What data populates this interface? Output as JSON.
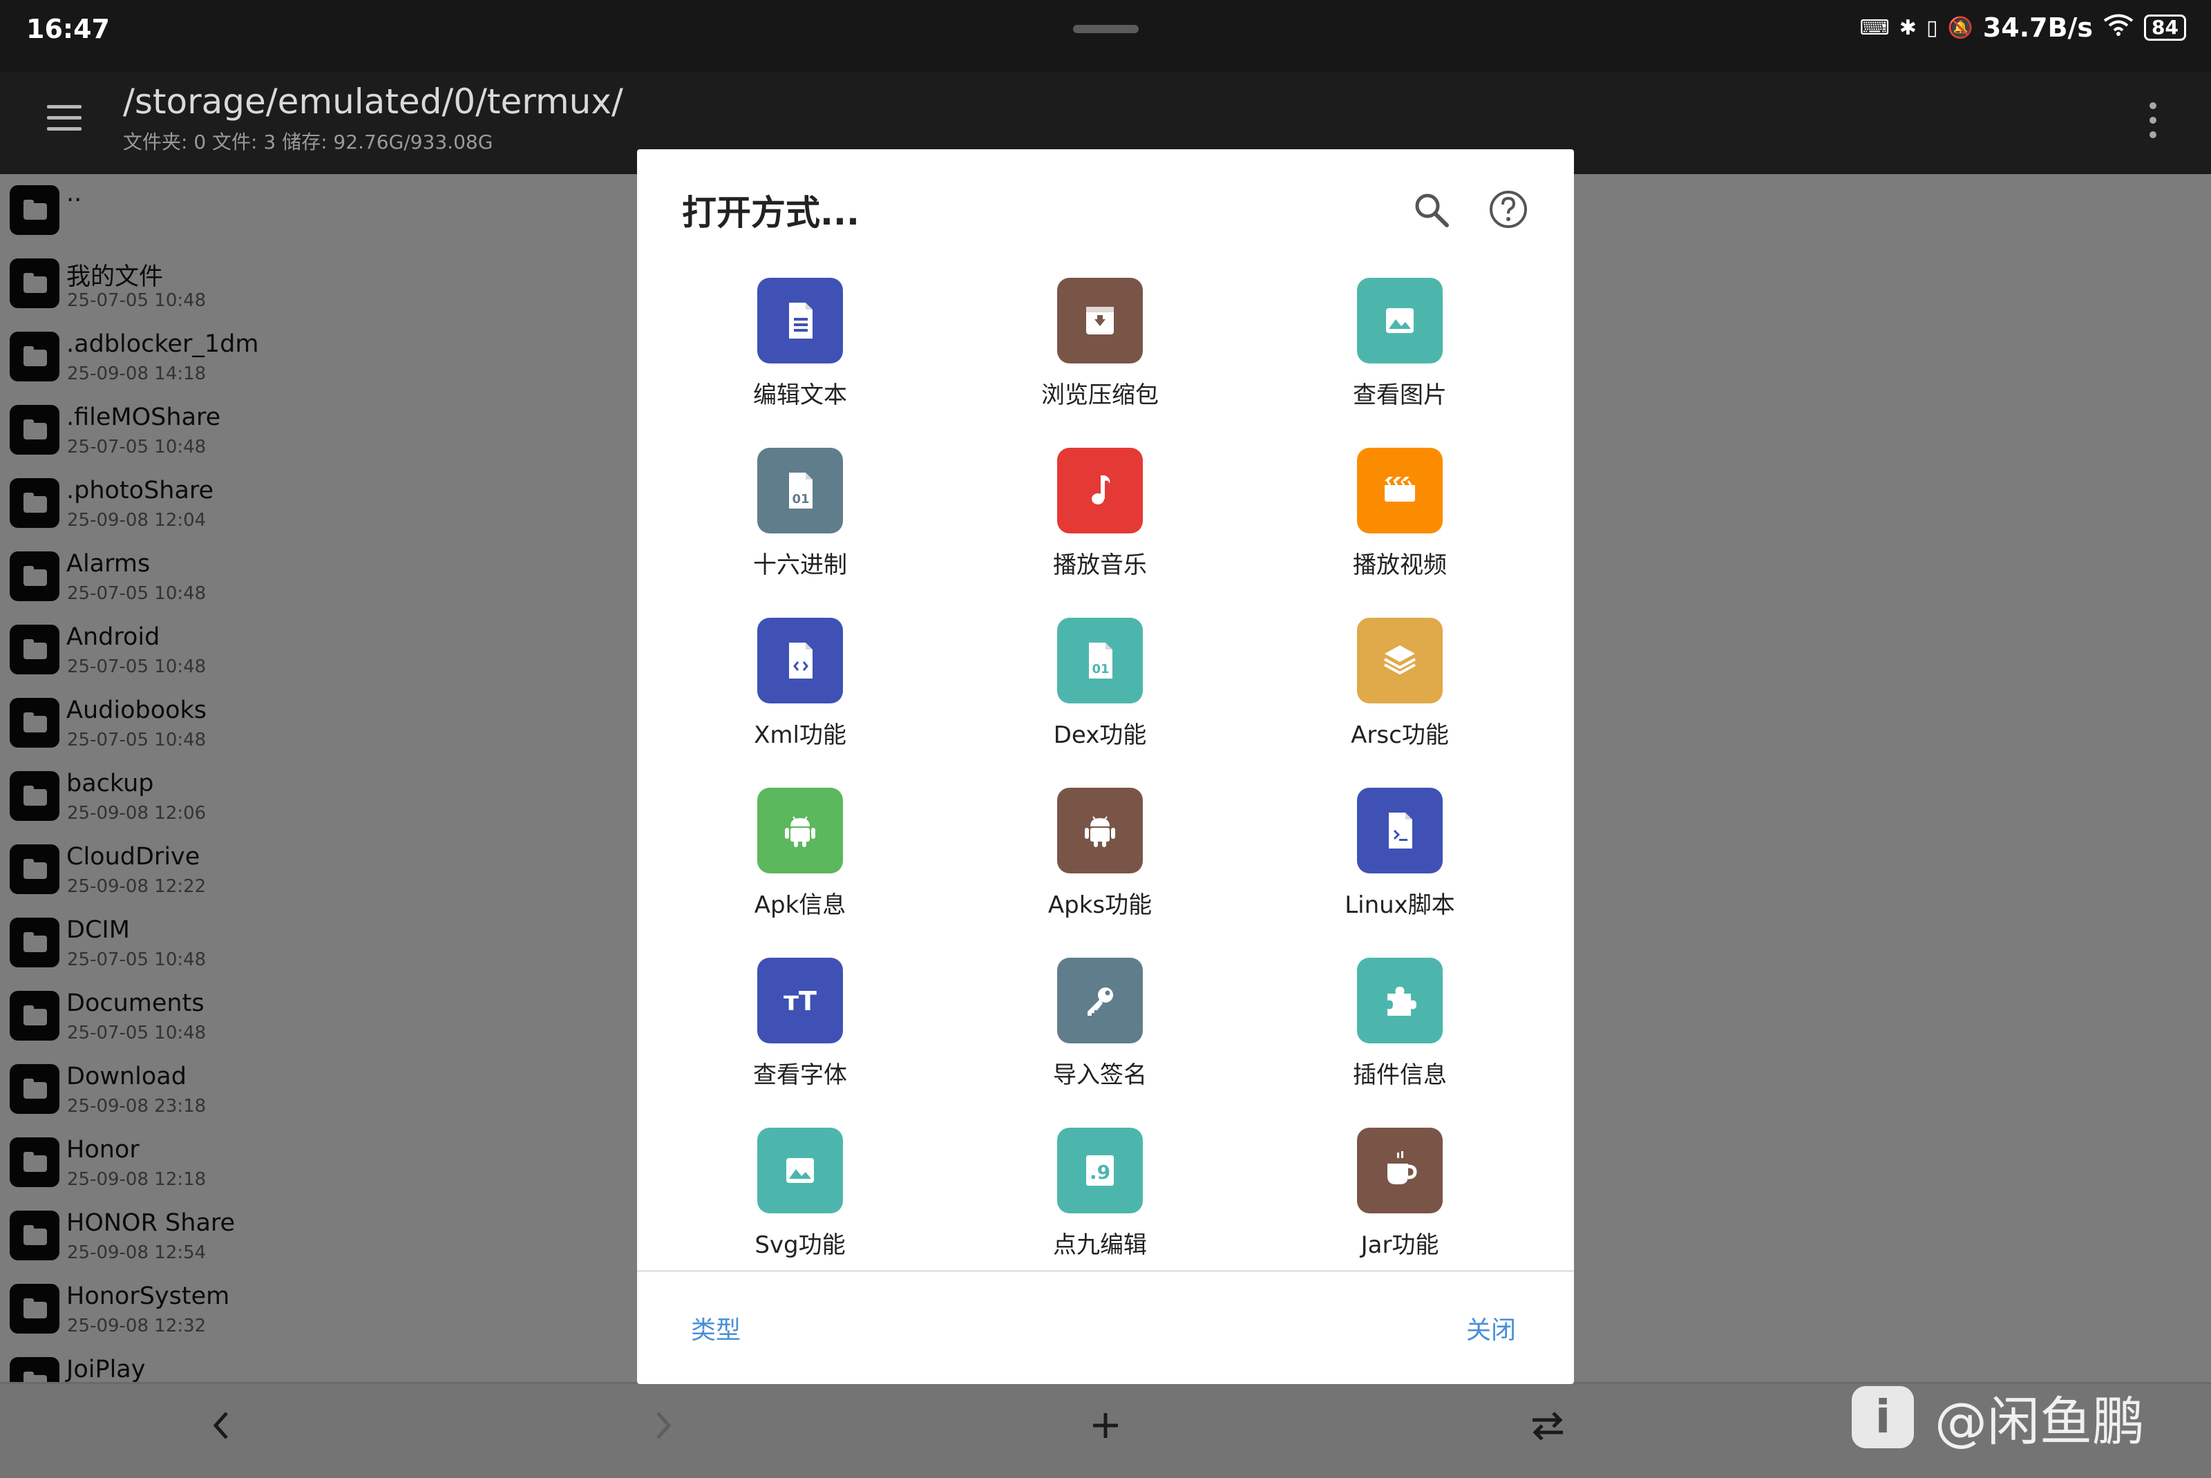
{
  "status_bar": {
    "time": "16:47",
    "net_speed": "34.7B/s",
    "battery": "84",
    "icons": [
      "keyboard-icon",
      "bluetooth-icon",
      "vibrate-icon",
      "mute-icon",
      "wifi-icon"
    ]
  },
  "toolbar": {
    "path": "/storage/emulated/0/termux/",
    "info": "文件夹: 0  文件: 3  储存: 92.76G/933.08G"
  },
  "files": [
    {
      "name": "..",
      "date": ""
    },
    {
      "name": "我的文件",
      "date": "25-07-05 10:48"
    },
    {
      "name": ".adblocker_1dm",
      "date": "25-09-08 14:18"
    },
    {
      "name": ".fileMOShare",
      "date": "25-07-05 10:48"
    },
    {
      "name": ".photoShare",
      "date": "25-09-08 12:04"
    },
    {
      "name": "Alarms",
      "date": "25-07-05 10:48"
    },
    {
      "name": "Android",
      "date": "25-07-05 10:48"
    },
    {
      "name": "Audiobooks",
      "date": "25-07-05 10:48"
    },
    {
      "name": "backup",
      "date": "25-09-08 12:06"
    },
    {
      "name": "CloudDrive",
      "date": "25-09-08 12:22"
    },
    {
      "name": "DCIM",
      "date": "25-07-05 10:48"
    },
    {
      "name": "Documents",
      "date": "25-07-05 10:48"
    },
    {
      "name": "Download",
      "date": "25-09-08 23:18"
    },
    {
      "name": "Honor",
      "date": "25-09-08 12:18"
    },
    {
      "name": "HONOR Share",
      "date": "25-09-08 12:54"
    },
    {
      "name": "HonorSystem",
      "date": "25-09-08 12:32"
    },
    {
      "name": "JoiPlay",
      "date": ""
    }
  ],
  "dialog": {
    "title": "打开方式...",
    "type_label": "类型",
    "close_label": "关闭",
    "apps": [
      {
        "label": "编辑文本",
        "icon": "text-file-icon",
        "color": "#3f51b5"
      },
      {
        "label": "浏览压缩包",
        "icon": "archive-icon",
        "color": "#795548"
      },
      {
        "label": "查看图片",
        "icon": "image-icon",
        "color": "#4db6ac"
      },
      {
        "label": "十六进制",
        "icon": "hex-file-icon",
        "color": "#607d8b"
      },
      {
        "label": "播放音乐",
        "icon": "music-icon",
        "color": "#e53935"
      },
      {
        "label": "播放视频",
        "icon": "video-icon",
        "color": "#fb8c00"
      },
      {
        "label": "Xml功能",
        "icon": "xml-file-icon",
        "color": "#3f51b5"
      },
      {
        "label": "Dex功能",
        "icon": "dex-file-icon",
        "color": "#4db6ac"
      },
      {
        "label": "Arsc功能",
        "icon": "layers-icon",
        "color": "#e0a94a"
      },
      {
        "label": "Apk信息",
        "icon": "android-icon",
        "color": "#5cb85c"
      },
      {
        "label": "Apks功能",
        "icon": "android-icon",
        "color": "#795548"
      },
      {
        "label": "Linux脚本",
        "icon": "script-file-icon",
        "color": "#3f51b5"
      },
      {
        "label": "查看字体",
        "icon": "font-icon",
        "color": "#3f51b5"
      },
      {
        "label": "导入签名",
        "icon": "key-icon",
        "color": "#607d8b"
      },
      {
        "label": "插件信息",
        "icon": "puzzle-icon",
        "color": "#4db6ac"
      },
      {
        "label": "Svg功能",
        "icon": "image-icon",
        "color": "#4db6ac"
      },
      {
        "label": "点九编辑",
        "icon": "ninepatch-icon",
        "color": "#4db6ac"
      },
      {
        "label": "Jar功能",
        "icon": "coffee-icon",
        "color": "#795548"
      }
    ]
  },
  "watermark": {
    "logo": "i",
    "text": "@闲鱼鹏"
  }
}
